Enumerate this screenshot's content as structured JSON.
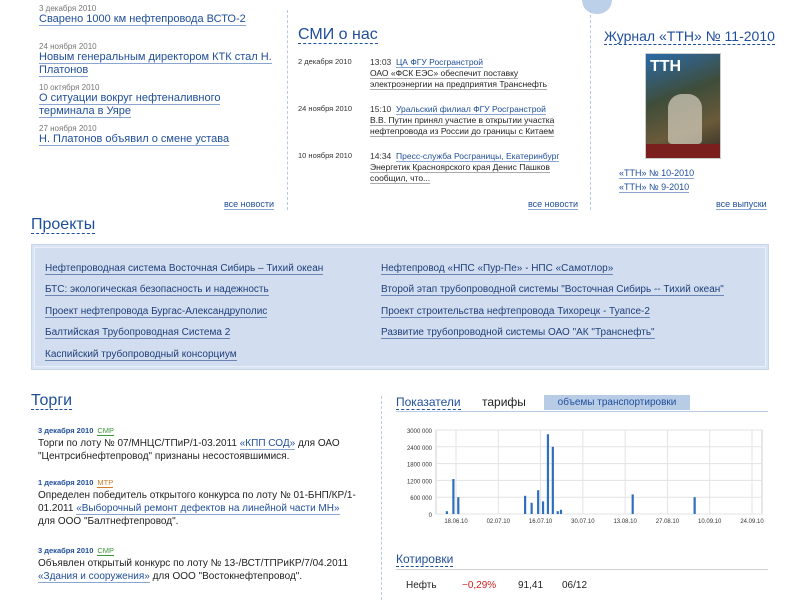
{
  "news": {
    "items": [
      {
        "date": "3 декабря 2010",
        "title": "Сварено 1000 км нефтепровода ВСТО-2"
      },
      {
        "date": "24 ноября 2010",
        "title": "Новым генеральным директором КТК стал Н. Платонов"
      },
      {
        "date": "10 октября 2010",
        "title": "О ситуации вокруг нефтеналивного терминала в Уяре"
      },
      {
        "date": "27 ноября 2010",
        "title": "Н. Платонов объявил о смене устава"
      }
    ],
    "more": "все новости"
  },
  "smi": {
    "title": "СМИ о нас",
    "items": [
      {
        "date": "2 декабря 2010",
        "time": "13:03",
        "source": "ЦА ФГУ Росгранстрой",
        "text": "ОАО «ФСК ЕЭС» обеспечит поставку электроэнергии на предприятия Транснефть"
      },
      {
        "date": "24 ноября 2010",
        "time": "15:10",
        "source": "Уральский филиал ФГУ Росгранстрой",
        "text": "В.В. Путин принял участие в открытии участка нефтепровода из России до границы с Китаем"
      },
      {
        "date": "10 ноября 2010",
        "time": "14:34",
        "source": "Пресс-служба Росграницы, Екатеринбург",
        "text": "Энергетик Красноярского края Денис Пашков сообщил, что..."
      }
    ],
    "more": "все новости"
  },
  "journal": {
    "title": "Журнал «ТТН» № 11-2010",
    "cover_logo": "ТТН",
    "issues": [
      "«ТТН» № 10-2010",
      "«ТТН» № 9-2010"
    ],
    "more": "все выпуски"
  },
  "projects": {
    "title": "Проекты",
    "left": [
      "Нефтепроводная система Восточная Сибирь – Тихий океан",
      "БТС: экологическая безопасность и надежность",
      "Проект нефтепровода Бургас-Александруполис",
      "Балтийская Трубопроводная Система 2",
      "Каспийский трубопроводный консорциум"
    ],
    "right": [
      "Нефтепровод «НПС «Пур-Пе» - НПС «Самотлор»",
      "Второй этап трубопроводной системы \"Восточная Сибирь -- Тихий океан\"",
      "Проект строительства нефтепровода Тихорецк - Туапсе-2",
      "Развитие трубопроводной системы ОАО \"АК \"Транснефть\""
    ]
  },
  "torgi": {
    "title": "Торги",
    "items": [
      {
        "date": "3 декабря 2010",
        "tag": "СМР",
        "tag_color": "#3a9a3a",
        "pre": "Торги по лоту № 07/МНЦС/ТПиР/1-03.2011 ",
        "link": "«КПП СОД»",
        "post": " для ОАО \"Центрсибнефтепровод\" признаны несостоявшимися."
      },
      {
        "date": "1 декабря 2010",
        "tag": "МТР",
        "tag_color": "#d07a2a",
        "pre": "Определен победитель открытого конкурса по лоту № 01-БНП/КР/1-01.2011 ",
        "link": "«Выборочный ремонт дефектов на линейной части МН»",
        "post": " для ООО \"Балтнефтепровод\"."
      },
      {
        "date": "3 декабря 2010",
        "tag": "СМР",
        "tag_color": "#3a9a3a",
        "pre": "Объявлен открытый конкурс по лоту № 13-/ВСТ/ТПРиКР/7/04.2011 ",
        "link": "«Здания и сооружения»",
        "post": " для ООО \"Востокнефтепровод\"."
      }
    ]
  },
  "indicators": {
    "title": "Показатели",
    "tab_tariffs": "тарифы",
    "tab_volumes": "объемы транспортировки"
  },
  "chart_data": {
    "type": "bar",
    "yticks": [
      "3000 000",
      "2400 000",
      "1800 000",
      "1200 000",
      "600 000",
      "0"
    ],
    "ylim": [
      0,
      3000000
    ],
    "xticks": [
      "18.06.10",
      "02.07.10",
      "16.07.10",
      "30.07.10",
      "13.08.10",
      "27.08.10",
      "10.09.10",
      "24.09.10"
    ],
    "bars": [
      {
        "x": 0.03,
        "value": 100000
      },
      {
        "x": 0.05,
        "value": 1250000
      },
      {
        "x": 0.065,
        "value": 600000
      },
      {
        "x": 0.27,
        "value": 650000
      },
      {
        "x": 0.29,
        "value": 400000
      },
      {
        "x": 0.31,
        "value": 850000
      },
      {
        "x": 0.325,
        "value": 450000
      },
      {
        "x": 0.34,
        "value": 2850000
      },
      {
        "x": 0.355,
        "value": 2400000
      },
      {
        "x": 0.37,
        "value": 100000
      },
      {
        "x": 0.38,
        "value": 150000
      },
      {
        "x": 0.6,
        "value": 700000
      },
      {
        "x": 0.79,
        "value": 600000
      }
    ]
  },
  "quotes": {
    "title": "Котировки",
    "row": {
      "name": "Нефть",
      "change": "−0,29%",
      "value": "91,41",
      "date": "06/12"
    }
  }
}
